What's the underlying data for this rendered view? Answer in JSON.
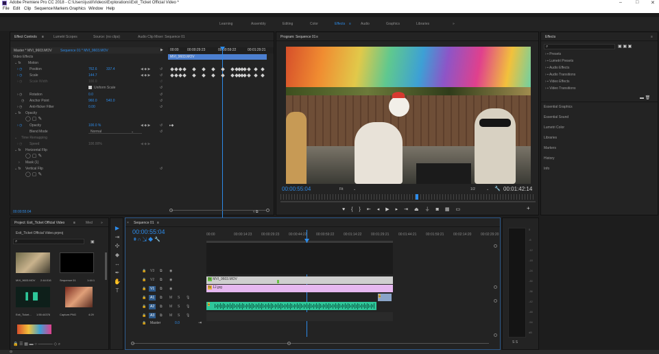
{
  "window": {
    "title": "Adobe Premiere Pro CC 2018 - C:\\Users\\justi\\Videos\\Explorations\\Exit_Ticket Official Video *",
    "minimize": "–",
    "maximize": "□",
    "close": "✕"
  },
  "menu": [
    "File",
    "Edit",
    "Clip",
    "Sequence",
    "Markers",
    "Graphics",
    "Window",
    "Help"
  ],
  "workspaces": [
    "Learning",
    "Assembly",
    "Editing",
    "Color",
    "Effects",
    "Audio",
    "Graphics",
    "Libraries"
  ],
  "workspace_more": "»",
  "effect_controls": {
    "tabs": [
      "Effect Controls",
      "Lumetri Scopes",
      "Source: (no clips)",
      "Audio Clip Mixer: Sequence 01"
    ],
    "tab_menu": "≡",
    "master": "Master * MVI_9603.MOV",
    "sequence": "Sequence 01 * MVI_9603.MOV",
    "ruler": [
      "00:00",
      "00:00:29:23",
      "00:00:59:22",
      "00:01:29:21"
    ],
    "clip_label": "MVI_9603.MOV",
    "video_effects": "Video Effects",
    "motion": "Motion",
    "position_label": "Position",
    "position_x": "762.6",
    "position_y": "337.4",
    "scale_label": "Scale",
    "scale_val": "144.7",
    "scale_width_label": "Scale Width",
    "scale_width_val": "100.0",
    "uniform_scale": "Uniform Scale",
    "rotation_label": "Rotation",
    "rotation_val": "0.0",
    "anchor_label": "Anchor Point",
    "anchor_x": "960.0",
    "anchor_y": "540.0",
    "antiflicker_label": "Anti-flicker Filter",
    "antiflicker_val": "0.00",
    "opacity_section": "Opacity",
    "opacity_label": "Opacity",
    "opacity_val": "100.0 %",
    "blend_label": "Blend Mode",
    "blend_val": "Normal",
    "time_remap": "Time Remapping",
    "speed_label": "Speed",
    "speed_val": "100.00%",
    "hflip": "Horizontal Flip",
    "mask": "Mask (1)",
    "vflip": "Vertical Flip",
    "timecode": "00:00:55:04"
  },
  "program": {
    "tab": "Program: Sequence 01",
    "tab_menu": "≡",
    "timecode": "00:00:55:04",
    "fit": "Fit",
    "res": "1/2",
    "duration": "00:01:42:14"
  },
  "effects_panel": {
    "title": "Effects",
    "tab_menu": "≡",
    "search_icon": "⌕",
    "folders": [
      "Presets",
      "Lumetri Presets",
      "Audio Effects",
      "Audio Transitions",
      "Video Effects",
      "Video Transitions"
    ],
    "sections": [
      "Essential Graphics",
      "Essential Sound",
      "Lumetri Color",
      "Libraries",
      "Markers",
      "History",
      "Info"
    ]
  },
  "project": {
    "tabs": [
      "Project: Exit_Ticket Official Video",
      "Med"
    ],
    "tab_menu": "≡",
    "tab_more": "»",
    "file": "Exit_Ticket Official Video.prproj",
    "items": [
      {
        "name": "MVI_9603.MOV",
        "dur": "2:44:016"
      },
      {
        "name": "Sequence 01",
        "dur": "1:44:1"
      },
      {
        "name": "Exit_Ticket...",
        "dur": "1:55:44376"
      },
      {
        "name": "Capture.PNG",
        "dur": "4:29"
      }
    ]
  },
  "timeline": {
    "tab": "Sequence 01",
    "tab_menu": "≡",
    "close": "×",
    "timecode": "00:00:55:04",
    "ruler": [
      "00:00",
      "00:00:14:23",
      "00:00:29:23",
      "00:00:44:22",
      "00:00:59:22",
      "00:01:14:22",
      "00:01:29:21",
      "00:01:44:21",
      "00:01:59:21",
      "00:02:14:20",
      "00:02:29:20"
    ],
    "tracks": [
      "V3",
      "V2",
      "V1",
      "A1",
      "A2",
      "A3"
    ],
    "master": "Master",
    "master_val": "0.0",
    "clip_v2": "MVI_9603.MOV",
    "clip_v1": "12.jpg",
    "vu_labels": [
      "0",
      "-6",
      "-12",
      "-18",
      "-24",
      "-30",
      "-36",
      "-42",
      "-48",
      "-54",
      "dB"
    ],
    "vu_bottom": "S   S"
  },
  "colors": {
    "accent": "#2d8ceb",
    "clip_purple": "#e6b8f0",
    "clip_audio": "#2ec79a",
    "clip_gray": "#cfcfcf"
  }
}
